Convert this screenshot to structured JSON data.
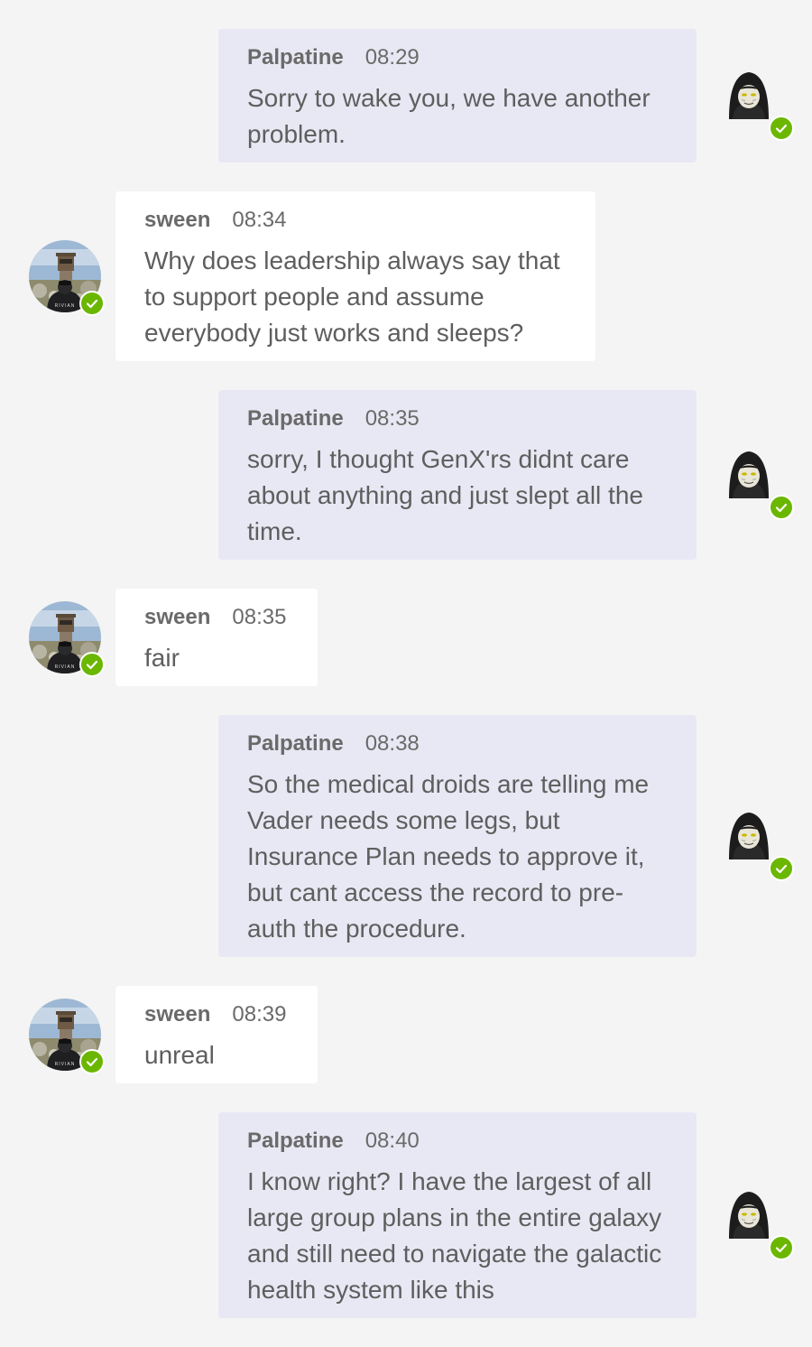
{
  "colors": {
    "self_bubble": "#e8e8f4",
    "other_bubble": "#ffffff",
    "background": "#f4f4f4",
    "presence_available": "#6bb700"
  },
  "messages": [
    {
      "sender": "Palpatine",
      "time": "08:29",
      "text": "Sorry to wake you, we have another\nproblem.",
      "side": "self",
      "avatar": "palpatine-avatar"
    },
    {
      "sender": "sween",
      "time": "08:34",
      "text": "Why does leadership always say that\nto support people and assume\neverybody just works and sleeps?",
      "side": "other",
      "avatar": "sween-avatar"
    },
    {
      "sender": "Palpatine",
      "time": "08:35",
      "text": "sorry, I thought GenX'rs didnt care\nabout anything and just slept all the\ntime.",
      "side": "self",
      "avatar": "palpatine-avatar"
    },
    {
      "sender": "sween",
      "time": "08:35",
      "text": "fair",
      "side": "other",
      "avatar": "sween-avatar"
    },
    {
      "sender": "Palpatine",
      "time": "08:38",
      "text": "So the medical droids are telling me\nVader needs some legs, but\nInsurance Plan needs to approve it,\nbut cant access the record to pre-\nauth the procedure.",
      "side": "self",
      "avatar": "palpatine-avatar"
    },
    {
      "sender": "sween",
      "time": "08:39",
      "text": "unreal",
      "side": "other",
      "avatar": "sween-avatar"
    },
    {
      "sender": "Palpatine",
      "time": "08:40",
      "text": "I know right? I have the largest of all\nlarge group plans in the entire galaxy\nand still need to navigate the galactic\nhealth system like this",
      "side": "self",
      "avatar": "palpatine-avatar"
    }
  ],
  "avatar_badge": {
    "status": "available",
    "icon": "check-icon"
  },
  "avatar_shirt_text": "RIVIAN"
}
